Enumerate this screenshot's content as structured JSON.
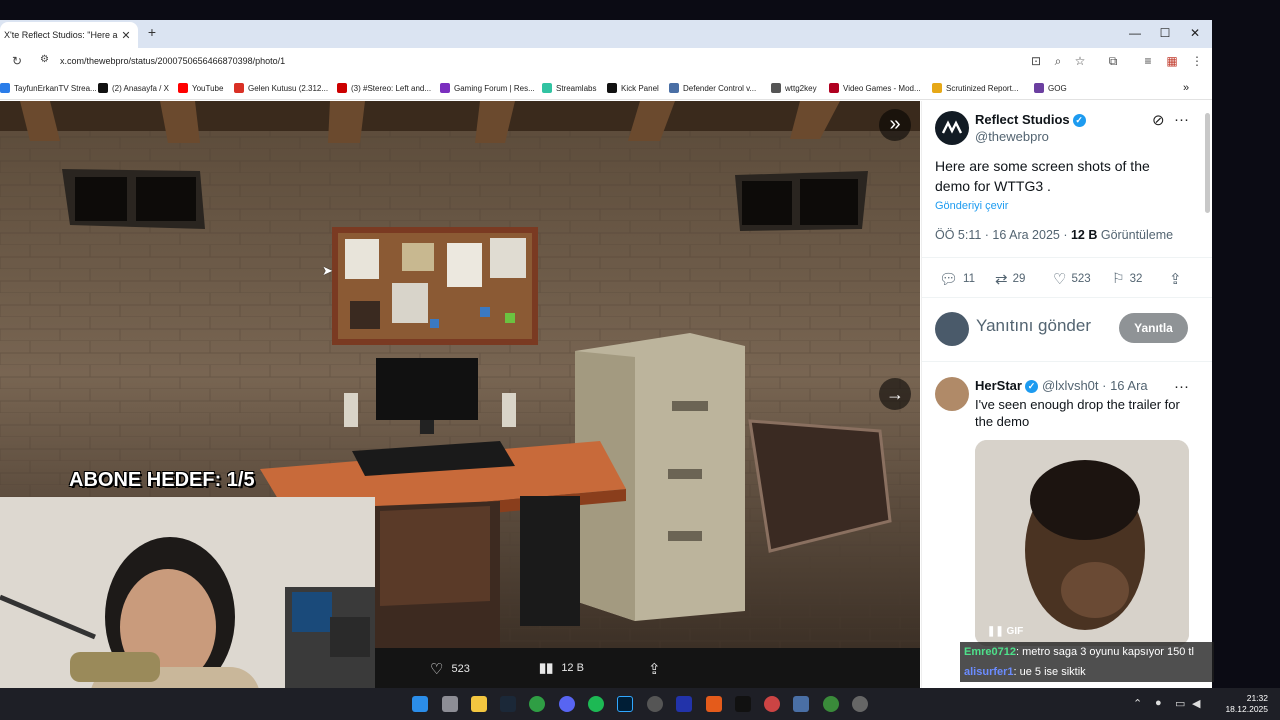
{
  "browser": {
    "tab_title": "X'te Reflect Studios: \"Here are s",
    "tab_close": "✕",
    "new_tab": "+",
    "url": "x.com/thewebpro/status/2000750656466870398/photo/1",
    "window_minimize": "—",
    "window_maximize": "☐",
    "window_close": "✕"
  },
  "bookmarks": [
    {
      "label": "TayfunErkanTV Strea...",
      "color": "#2b7de9"
    },
    {
      "label": "(2) Anasayfa / X",
      "color": "#111111"
    },
    {
      "label": "YouTube",
      "color": "#ff0000"
    },
    {
      "label": "Gelen Kutusu (2.312...",
      "color": "#d93025"
    },
    {
      "label": "(3) #Stereo: Left and...",
      "color": "#cc0000"
    },
    {
      "label": "Gaming Forum | Res...",
      "color": "#7b2fbf"
    },
    {
      "label": "Streamlabs",
      "color": "#31c3a2"
    },
    {
      "label": "Kick Panel",
      "color": "#111111"
    },
    {
      "label": "Defender Control v...",
      "color": "#4a6fa5"
    },
    {
      "label": "wttg2key",
      "color": "#555555"
    },
    {
      "label": "Video Games - Mod...",
      "color": "#b00020"
    },
    {
      "label": "Scrutinized Report...",
      "color": "#e6a817"
    },
    {
      "label": "GOG",
      "color": "#6b3fa0"
    }
  ],
  "media": {
    "likes": "523",
    "views": "12 B"
  },
  "tweet": {
    "name": "Reflect Studios",
    "handle": "@thewebpro",
    "text": "Here are some screen shots of the demo for WTTG3 .",
    "translate": "Gönderiyi çevir",
    "time": "ÖÖ 5:11 · 16 Ara 2025 · ",
    "views_count": "12 B",
    "views_label": " Görüntüleme",
    "replies": "11",
    "retweets": "29",
    "likes": "523",
    "bookmarks": "32",
    "reply_placeholder": "Yanıtını gönder",
    "reply_button": "Yanıtla"
  },
  "reply": {
    "name": "HerStar",
    "handle": "@lxlvsh0t · 16 Ara",
    "text": "I've seen enough drop the trailer for the demo",
    "gif_label": "GIF"
  },
  "overlay": {
    "goal": "ABONE HEDEF: 1/5"
  },
  "chat": [
    {
      "user": "Emre0712",
      "message": ": metro saga 3 oyunu kapsıyor 150 tl",
      "color": "#4ee08a"
    },
    {
      "user": "alisurfer1",
      "message": ": ue 5 ise siktik",
      "color": "#6b8cff"
    }
  ],
  "taskbar": {
    "time": "21:32",
    "date": "18.12.2025"
  }
}
